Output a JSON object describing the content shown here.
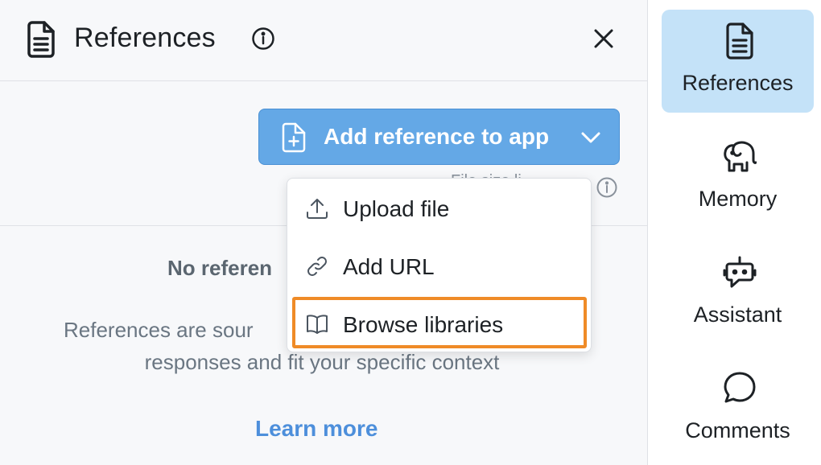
{
  "panel": {
    "title": "References",
    "add_button_label": "Add reference to app",
    "hint": "File size li",
    "empty_title": "No referen",
    "empty_desc_line1": "References are sour",
    "empty_desc_line2": "responses and fit your specific context",
    "learn_more": "Learn more"
  },
  "dropdown": {
    "items": [
      {
        "label": "Upload file",
        "icon": "upload-icon"
      },
      {
        "label": "Add URL",
        "icon": "link-icon"
      },
      {
        "label": "Browse libraries",
        "icon": "book-open-icon"
      }
    ]
  },
  "sidebar": {
    "items": [
      {
        "label": "References",
        "icon": "document-icon",
        "active": true
      },
      {
        "label": "Memory",
        "icon": "elephant-icon"
      },
      {
        "label": "Assistant",
        "icon": "robot-icon"
      },
      {
        "label": "Comments",
        "icon": "chat-bubble-icon"
      }
    ]
  },
  "colors": {
    "accent": "#64a8e6",
    "active_tab": "#c4e2f8",
    "highlight": "#ef8b27",
    "link": "#4d8fdb"
  }
}
